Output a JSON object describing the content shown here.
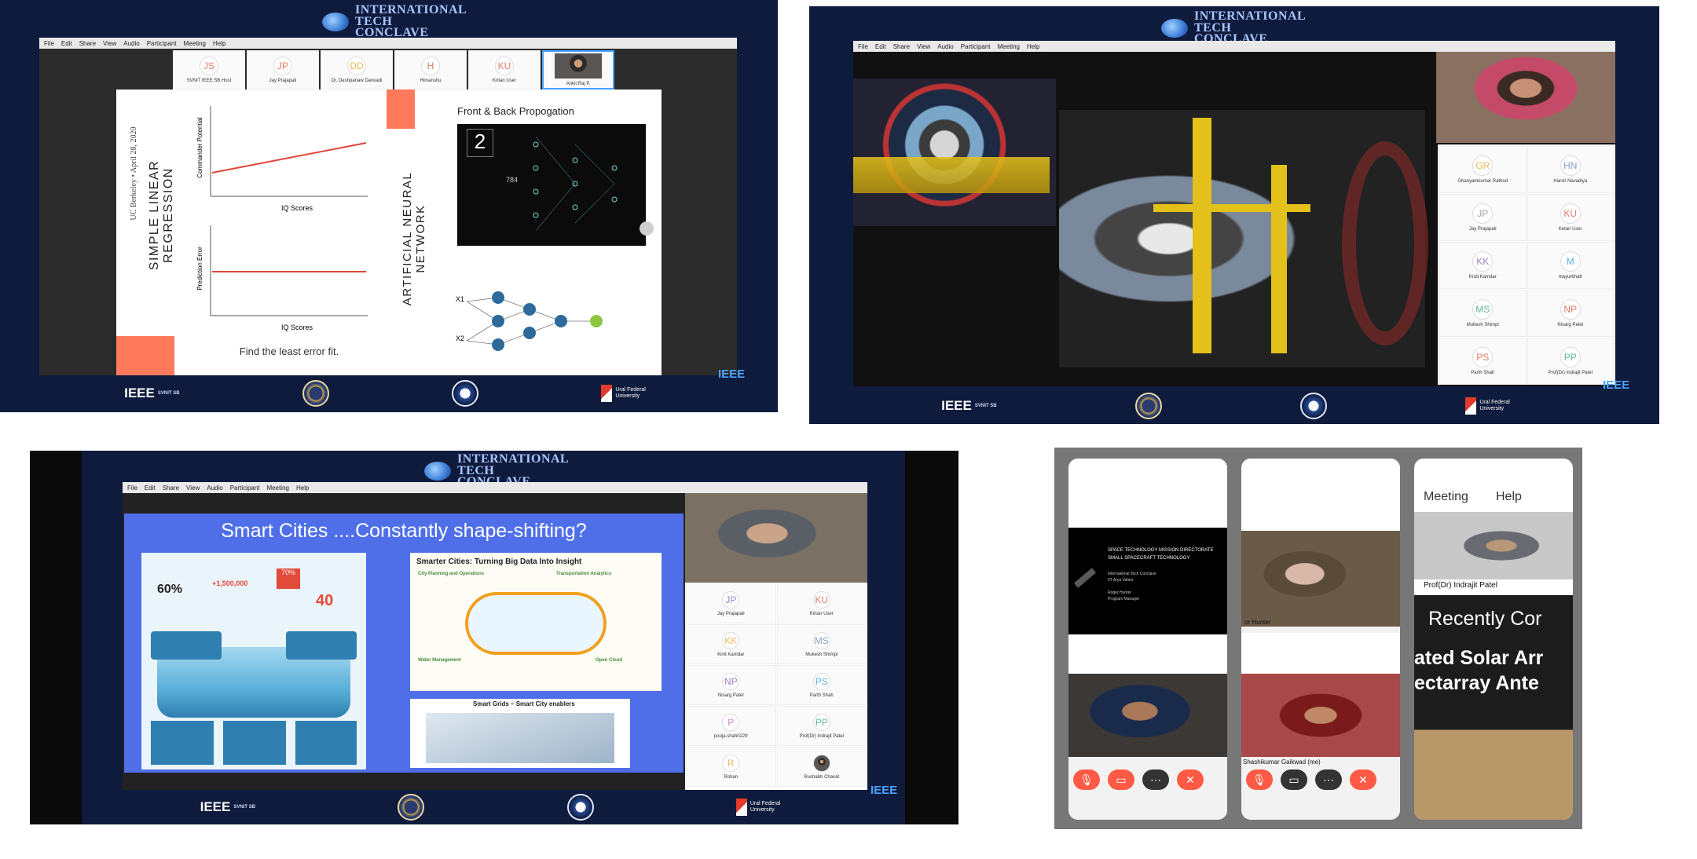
{
  "conclave": [
    "INTERNATIONAL",
    "TECH",
    "CONCLAVE"
  ],
  "menu": [
    "File",
    "Edit",
    "Share",
    "View",
    "Audio",
    "Participant",
    "Meeting",
    "Help"
  ],
  "footer": {
    "ieee": "IEEE",
    "ieee_sub": "SVNIT SB",
    "ural_line1": "Ural Federal",
    "ural_line2": "University",
    "watermark": "IEEE"
  },
  "panel1": {
    "participants": [
      {
        "initials": "JS",
        "name": "SVNIT IEEE SB Host"
      },
      {
        "initials": "JP",
        "name": "Jay Prajapati"
      },
      {
        "initials": "DD",
        "name": "Dr. Deshpanaw Darwadi"
      },
      {
        "initials": "H",
        "name": "Himanshu"
      },
      {
        "initials": "KU",
        "name": "Kirtan User"
      },
      {
        "initials": "",
        "name": "Ankit Raj P."
      }
    ],
    "slide_left": {
      "vertical_title": "SIMPLE LINEAR REGRESSION",
      "vertical_sub": "UC Berkeley • April 28, 2020",
      "chart1_ylabel": "Commander Potential",
      "chart1_xlabel": "IQ Scores",
      "chart2_ylabel": "Prediction Error",
      "chart2_xlabel": "IQ Scores",
      "caption": "Find the least error fit."
    },
    "slide_right": {
      "vertical_title": "ARTIFICIAL NEURAL NETWORK",
      "heading": "Front & Back Propogation",
      "digit": "2",
      "number": "784",
      "x1": "X1",
      "x2": "X2"
    }
  },
  "panel2": {
    "participants": [
      {
        "initials": "GR",
        "name": "Ghanyamkumar Rathod",
        "color": "#e9b85b"
      },
      {
        "initials": "HN",
        "name": "Harsh Navadiya",
        "color": "#8aa0c8"
      },
      {
        "initials": "JP",
        "name": "Jay Prajapati",
        "color": "#9aa2b0"
      },
      {
        "initials": "KU",
        "name": "Ketan User",
        "color": "#e27b65"
      },
      {
        "initials": "KK",
        "name": "Kruti Kamdar",
        "color": "#9b7fc6"
      },
      {
        "initials": "M",
        "name": "mayurbhatt",
        "color": "#5aaed8"
      },
      {
        "initials": "MS",
        "name": "Mukesh Shimpi",
        "color": "#61b98c"
      },
      {
        "initials": "NP",
        "name": "Nisarg Patel",
        "color": "#e27b65"
      },
      {
        "initials": "PS",
        "name": "Parth Shah",
        "color": "#e27b65"
      },
      {
        "initials": "PP",
        "name": "Prof(Dr) Indrajit Patel",
        "color": "#61b98c"
      }
    ]
  },
  "panel3": {
    "slide_title": "Smart Cities ....Constantly shape-shifting?",
    "info_title": "Smarter Cities: Turning Big Data Into Insight",
    "info_labels": [
      "City Planning and Operations",
      "Transportation Analytics",
      "Water Management",
      "Open Cloud"
    ],
    "stats": [
      "60%",
      "+1,500,000",
      "70%",
      "40"
    ],
    "smart_grid": "Smart Grids – Smart City enablers",
    "participants": [
      {
        "initials": "JP",
        "name": "Jay Prajapati",
        "color": "#9b7fc6"
      },
      {
        "initials": "KU",
        "name": "Kirtan User",
        "color": "#e27b65"
      },
      {
        "initials": "KK",
        "name": "Kinit Kamdar",
        "color": "#e9b85b"
      },
      {
        "initials": "MS",
        "name": "Mukesh Shimpi",
        "color": "#8aa0c8"
      },
      {
        "initials": "NP",
        "name": "Nisarg Patel",
        "color": "#9b7fc6"
      },
      {
        "initials": "PS",
        "name": "Parth Shah",
        "color": "#5aaed8"
      },
      {
        "initials": "P",
        "name": "pooja.shah0229",
        "color": "#c97fc6"
      },
      {
        "initials": "PP",
        "name": "Prof(Dr) Indrajit Patel",
        "color": "#61b98c"
      },
      {
        "initials": "R",
        "name": "Rohan",
        "color": "#e9b85b"
      },
      {
        "initials": "",
        "name": "Rushabh Chavat",
        "color": "#9aa2b0"
      }
    ]
  },
  "panel4": {
    "phone1": {
      "slide_line1": "SPACE TECHNOLOGY MISSION DIRECTORATE",
      "slide_line2": "SMALL SPACECRAFT TECHNOLOGY",
      "slide_line3": "International Tech Conclave",
      "slide_line4": "IIT Arya Vahini",
      "slide_line5": "Roger Hunter",
      "slide_line6": "Program Manager"
    },
    "phone2": {
      "name_top": "or Hunter",
      "name_bottom": "Shashikumar Gaikwad (me)"
    },
    "phone3": {
      "menu_meeting": "Meeting",
      "menu_help": "Help",
      "person": "Prof(Dr) Indrajit Patel",
      "recent": "Recently Cor",
      "line1": "ated Solar Arr",
      "line2": "ectarray Ante"
    }
  }
}
